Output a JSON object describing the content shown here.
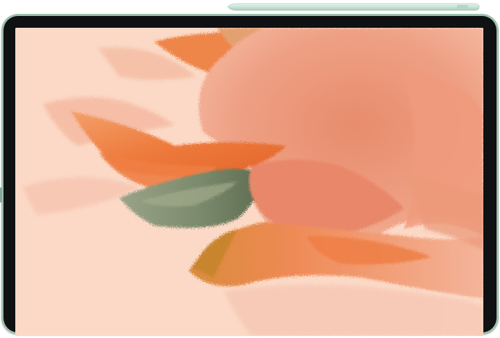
{
  "device": {
    "frame_color": "#9fbfad",
    "bezel_color": "#0f1112",
    "stylus_color": "#c9e4d6",
    "camera_icon": "front-camera-icon"
  },
  "wallpaper": {
    "background_color": "#fbd9c6",
    "colors": {
      "coral": "#f0987a",
      "orange": "#ee7a3c",
      "deep_orange": "#e2652a",
      "salmon": "#e79a7c",
      "pink_dust": "#f4b49b",
      "olive": "#7b8a6c",
      "dark_olive": "#5d6b50",
      "gold": "#d98b3b"
    }
  }
}
